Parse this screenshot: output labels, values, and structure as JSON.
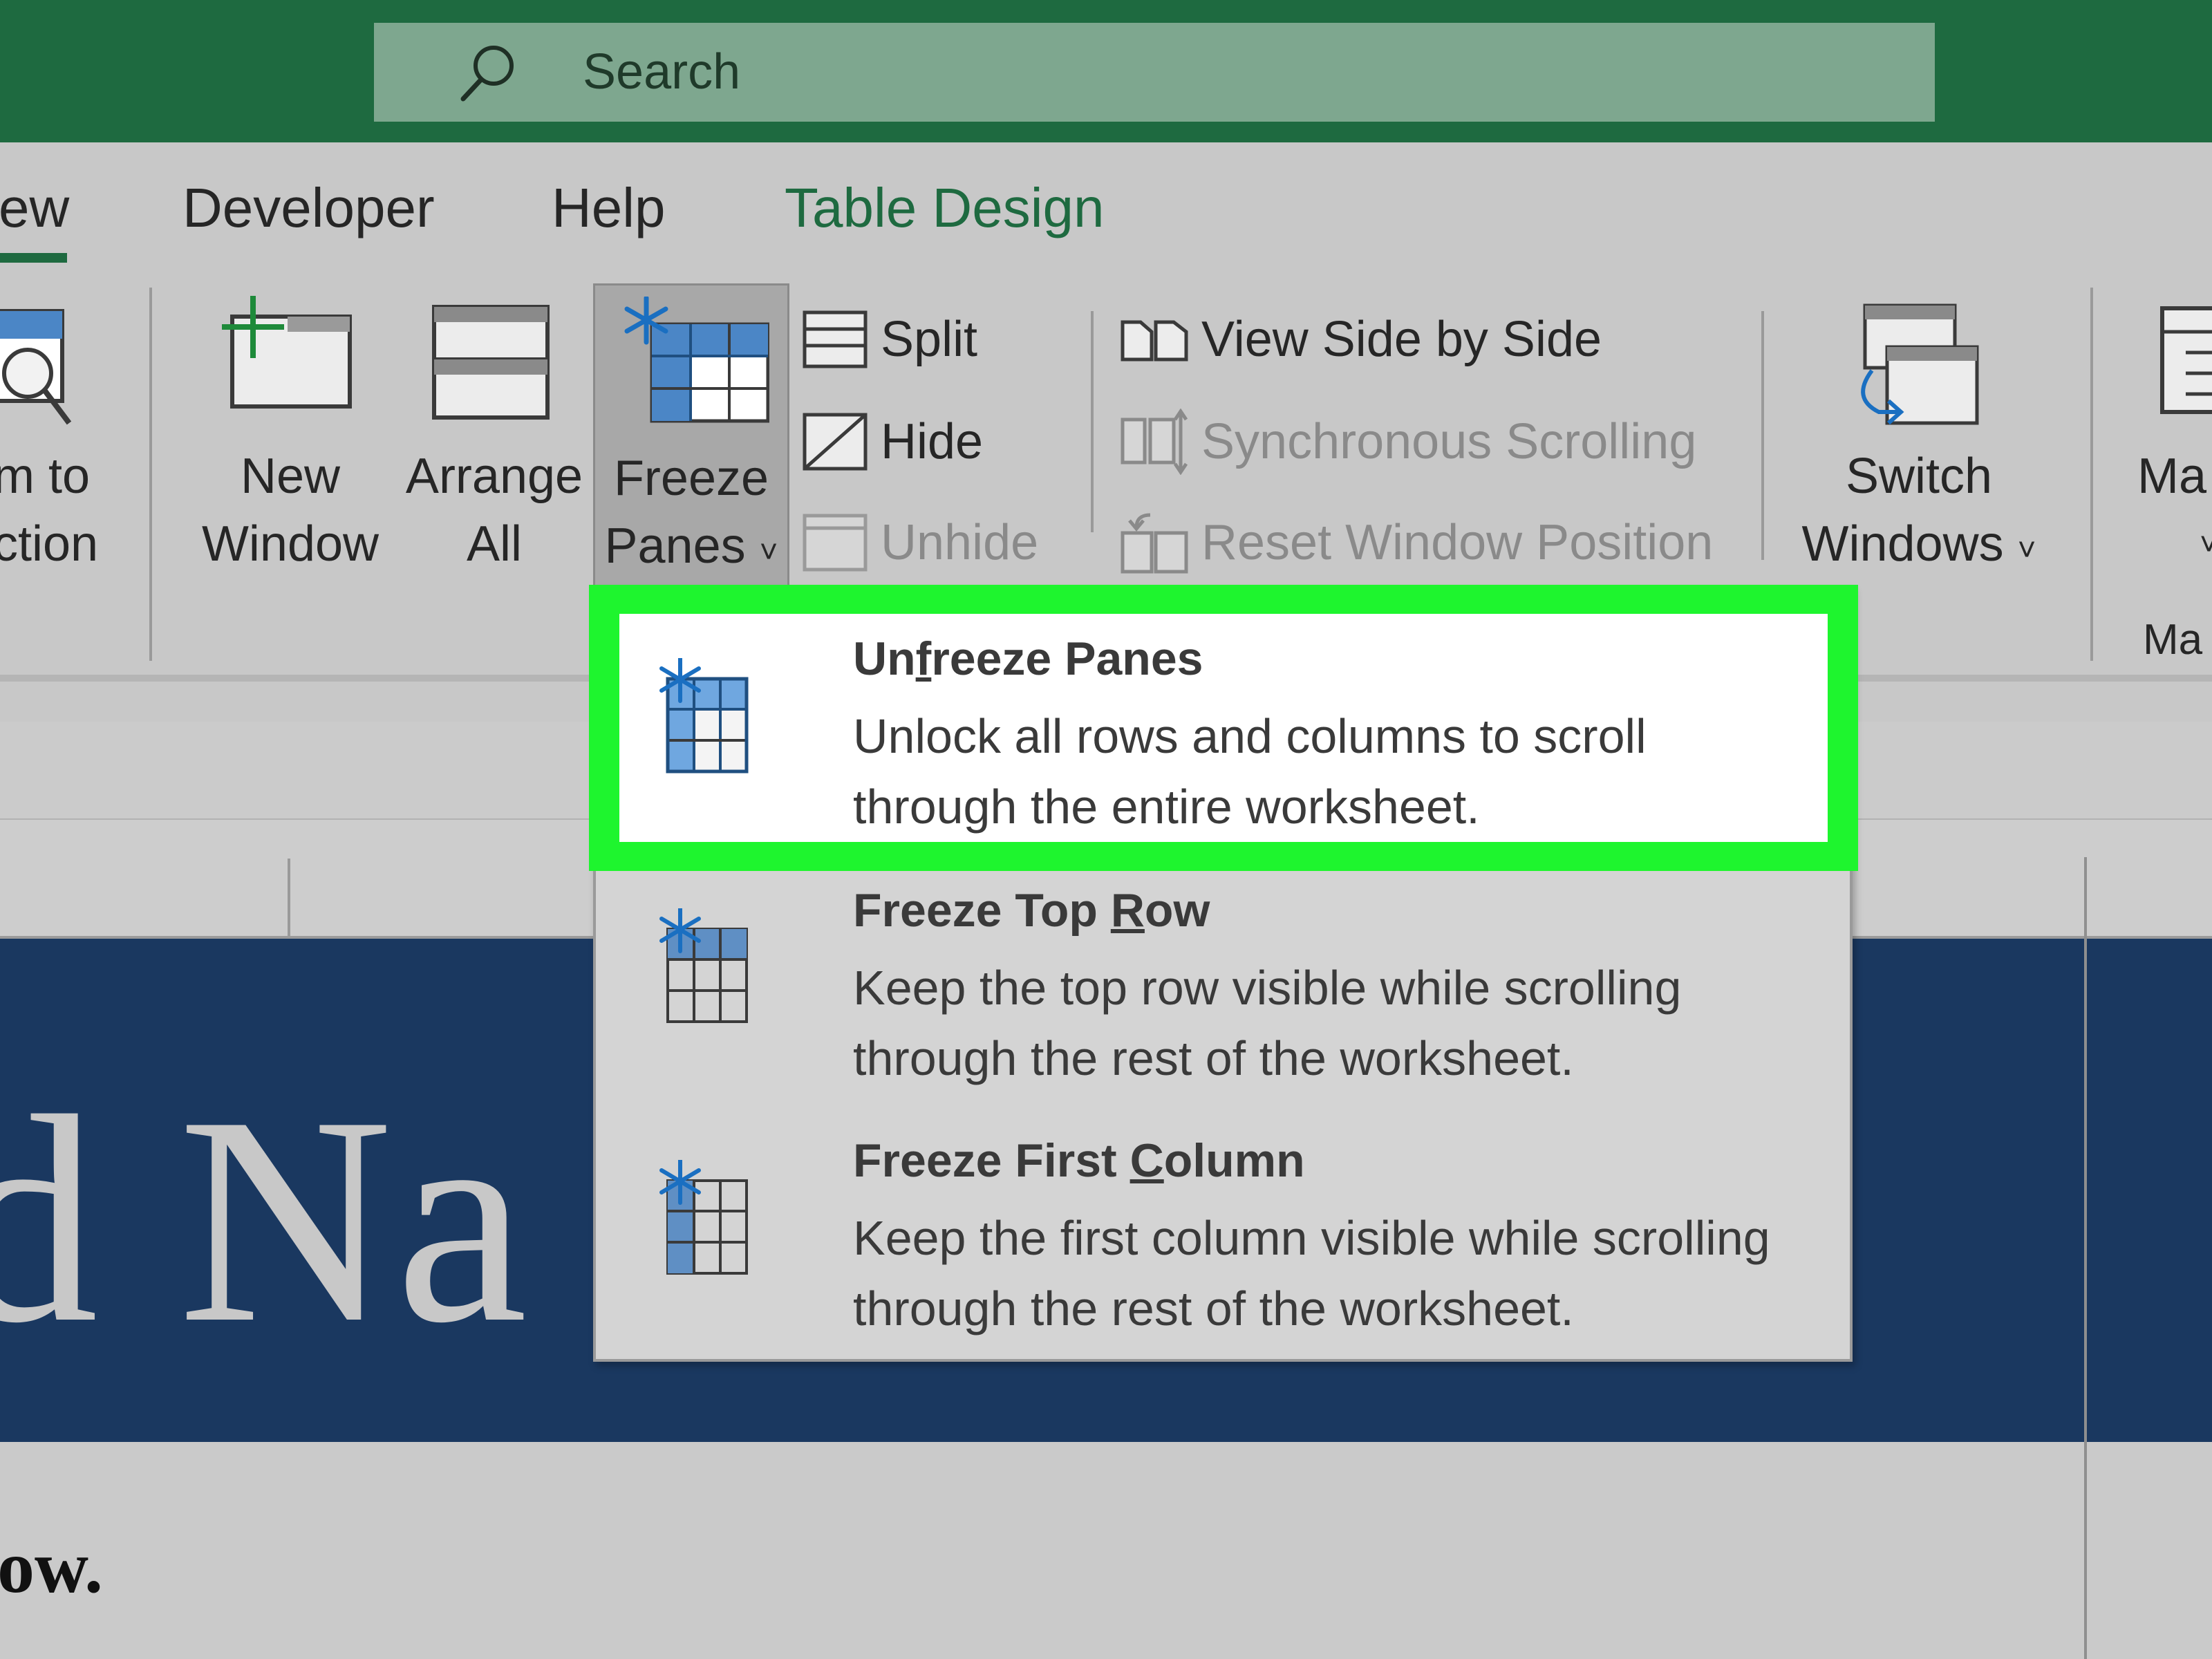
{
  "search": {
    "placeholder": "Search"
  },
  "tabs": [
    {
      "label": "ew"
    },
    {
      "label": "Developer"
    },
    {
      "label": "Help"
    },
    {
      "label": "Table Design"
    }
  ],
  "ribbon": {
    "zoom_to_selection": {
      "line1": "m to",
      "line2": "ction"
    },
    "new_window": {
      "line1": "New",
      "line2": "Window"
    },
    "arrange_all": {
      "line1": "Arrange",
      "line2": "All"
    },
    "freeze_panes": {
      "line1": "Freeze",
      "line2": "Panes",
      "caret": "˅"
    },
    "split": "Split",
    "hide": "Hide",
    "unhide": "Unhide",
    "view_side_by_side": "View Side by Side",
    "synchronous_scrolling": "Synchronous Scrolling",
    "reset_window_position": "Reset Window Position",
    "switch_windows": {
      "line1": "Switch",
      "line2": "Windows",
      "caret": "˅"
    },
    "macros": {
      "line1": "Ma",
      "line2": "˅",
      "group": "Ma"
    }
  },
  "menu": {
    "items": [
      {
        "title_pre": "Un",
        "title_key": "f",
        "title_post": "reeze Panes",
        "desc_line1": "Unlock all rows and columns to scroll",
        "desc_line2": "through the entire worksheet."
      },
      {
        "title_pre": "Freeze Top ",
        "title_key": "R",
        "title_post": "ow",
        "desc_line1": "Keep the top row visible while scrolling",
        "desc_line2": "through the rest of the worksheet."
      },
      {
        "title_pre": "Freeze First ",
        "title_key": "C",
        "title_post": "olumn",
        "desc_line1": "Keep the first column visible while scrolling",
        "desc_line2": "through the rest of the worksheet."
      }
    ]
  },
  "sheet": {
    "banner_text": "rd Na",
    "below_text": "elow."
  },
  "colors": {
    "titlebar": "#1e6a40",
    "highlight": "#1ef52e",
    "banner": "#1a3860"
  }
}
